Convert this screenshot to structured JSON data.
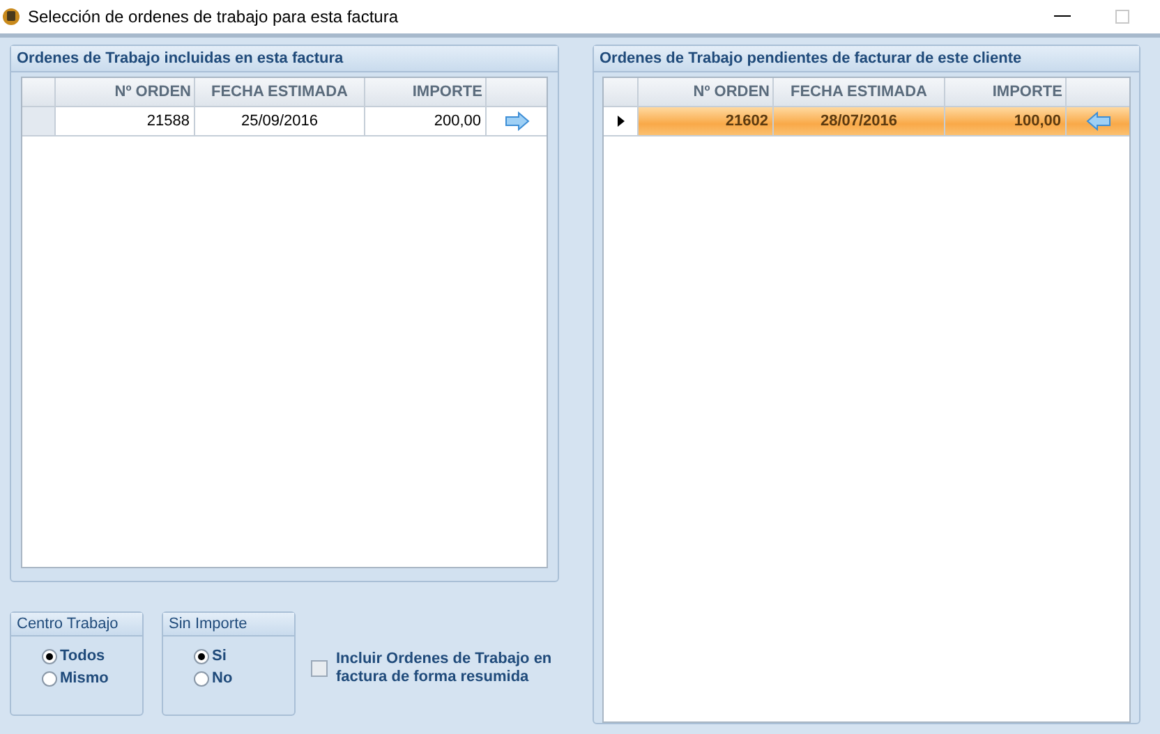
{
  "window": {
    "title": "Selección de ordenes de trabajo para esta factura"
  },
  "panels": [
    {
      "title": "Ordenes de Trabajo incluidas en esta factura",
      "columns": [
        "Nº ORDEN",
        "FECHA ESTIMADA",
        "IMPORTE"
      ],
      "kind": "included",
      "rows": [
        {
          "orden": "21588",
          "fecha": "25/09/2016",
          "importe": "200,00",
          "selected": false
        }
      ]
    },
    {
      "title": "Ordenes de Trabajo pendientes de facturar de este cliente",
      "columns": [
        "Nº ORDEN",
        "FECHA ESTIMADA",
        "IMPORTE"
      ],
      "kind": "pending",
      "rows": [
        {
          "orden": "21602",
          "fecha": "28/07/2016",
          "importe": "100,00",
          "selected": true
        }
      ]
    }
  ],
  "groups": [
    {
      "title": "Centro Trabajo",
      "options": [
        {
          "label": "Todos",
          "selected": true
        },
        {
          "label": "Mismo",
          "selected": false
        }
      ]
    },
    {
      "title": "Sin Importe",
      "options": [
        {
          "label": "Si",
          "selected": true
        },
        {
          "label": "No",
          "selected": false
        }
      ]
    }
  ],
  "checkbox": {
    "label": "Incluir Ordenes de Trabajo en factura de forma resumida",
    "checked": false
  }
}
